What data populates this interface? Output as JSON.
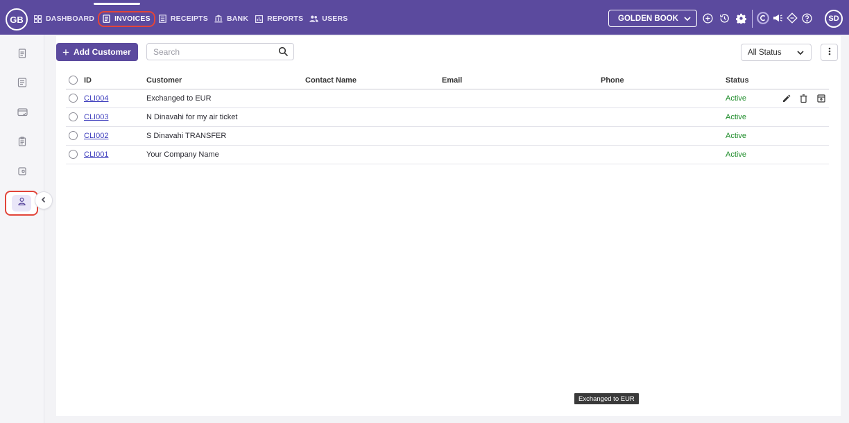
{
  "app": {
    "logo_text": "GB",
    "user_initials": "SD"
  },
  "nav": {
    "items": [
      {
        "label": "DASHBOARD",
        "icon": "grid-icon"
      },
      {
        "label": "INVOICES",
        "icon": "document-icon",
        "active": true
      },
      {
        "label": "RECEIPTS",
        "icon": "list-icon"
      },
      {
        "label": "BANK",
        "icon": "bank-icon"
      },
      {
        "label": "REPORTS",
        "icon": "chart-icon"
      },
      {
        "label": "USERS",
        "icon": "users-icon"
      }
    ]
  },
  "book": {
    "selected": "GOLDEN BOOK"
  },
  "top_icons": [
    "add-circle-icon",
    "history-icon",
    "settings-icon",
    "currency-icon",
    "megaphone-icon",
    "diamond-icon",
    "help-icon"
  ],
  "sidebar": {
    "items": [
      "invoice-icon",
      "document-list-icon",
      "card-icon",
      "clipboard-icon",
      "wallet-icon",
      "customer-icon"
    ],
    "active_index": 5
  },
  "toolbar": {
    "add_label": "Add Customer",
    "search_placeholder": "Search",
    "status_filter": "All Status"
  },
  "table": {
    "headers": {
      "id": "ID",
      "customer": "Customer",
      "contact": "Contact Name",
      "email": "Email",
      "phone": "Phone",
      "status": "Status"
    },
    "rows": [
      {
        "id": "CLI004",
        "customer": "Exchanged to EUR",
        "contact": "",
        "email": "",
        "phone": "",
        "status": "Active"
      },
      {
        "id": "CLI003",
        "customer": "N Dinavahi for my air ticket",
        "contact": "",
        "email": "",
        "phone": "",
        "status": "Active"
      },
      {
        "id": "CLI002",
        "customer": "S Dinavahi TRANSFER",
        "contact": "",
        "email": "",
        "phone": "",
        "status": "Active"
      },
      {
        "id": "CLI001",
        "customer": "Your Company Name",
        "contact": "",
        "email": "",
        "phone": "",
        "status": "Active"
      }
    ]
  },
  "tooltip": {
    "text": "Exchanged to EUR"
  },
  "colors": {
    "brand": "#5b4a9e",
    "active_status": "#1e8c2a",
    "highlight": "#e2453a"
  }
}
